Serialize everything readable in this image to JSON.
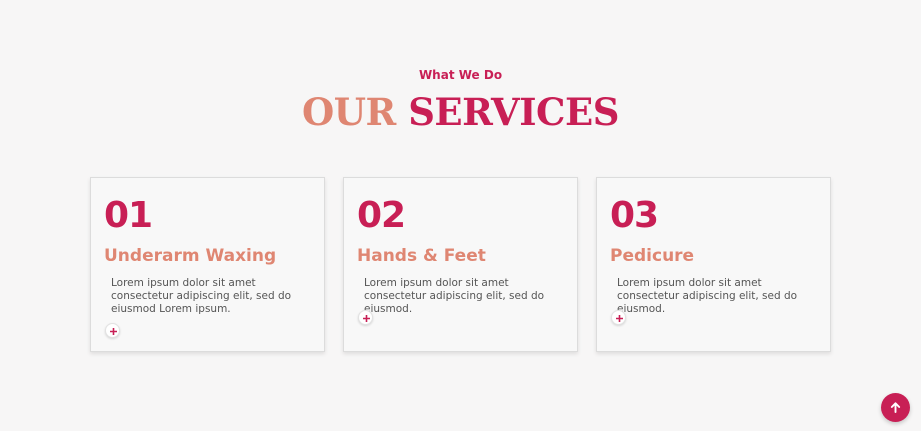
{
  "section": {
    "eyebrow": "What We Do",
    "heading_word1": "OUR",
    "heading_word2": "SERVICES"
  },
  "services": [
    {
      "number": "01",
      "title": "Underarm Waxing",
      "description": "Lorem ipsum dolor sit amet consectetur adipiscing elit, sed do eiusmod Lorem ipsum.",
      "expand_icon": "plus-icon"
    },
    {
      "number": "02",
      "title": "Hands & Feet",
      "description": "Lorem ipsum dolor sit amet consectetur adipiscing elit, sed do eiusmod.",
      "expand_icon": "plus-icon"
    },
    {
      "number": "03",
      "title": "Pedicure",
      "description": "Lorem ipsum dolor sit amet consectetur adipiscing elit, sed do eiusmod.",
      "expand_icon": "plus-icon"
    }
  ],
  "back_to_top": {
    "icon": "arrow-up-icon"
  },
  "colors": {
    "accent": "#c81f55",
    "secondary": "#df8672",
    "text": "#555555",
    "background": "#f7f6f6"
  }
}
